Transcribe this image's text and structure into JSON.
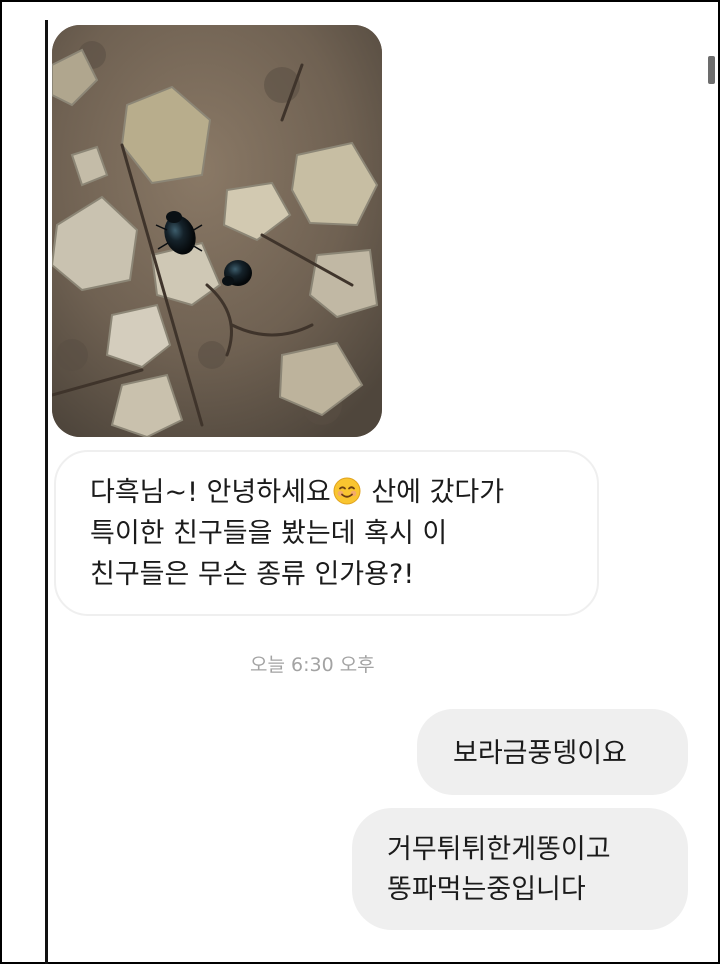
{
  "thread": {
    "photo": {
      "subject": "two dark beetles on rocky soil"
    },
    "incoming_message": {
      "lines": [
        {
          "before_emoji": "다흑님~! 안녕하세요",
          "emoji": "smiling-face-emoji",
          "after_emoji": " 산에 갔다가"
        },
        {
          "text": "특이한 친구들을 봤는데 혹시 이"
        },
        {
          "text": "친구들은 무슨 종류 인가용?!"
        }
      ]
    },
    "timestamp": "오늘 6:30 오후",
    "outgoing_messages": [
      {
        "lines": [
          "보라금풍뎅이요"
        ]
      },
      {
        "lines": [
          "거무튀튀한게똥이고",
          "똥파먹는중입니다"
        ]
      }
    ]
  },
  "colors": {
    "page_background": "#ffffff",
    "outgoing_bubble": "#efefef",
    "incoming_bubble_border": "#efefef",
    "timestamp_text": "#a3a3a3",
    "message_text": "#1b1b1b"
  }
}
